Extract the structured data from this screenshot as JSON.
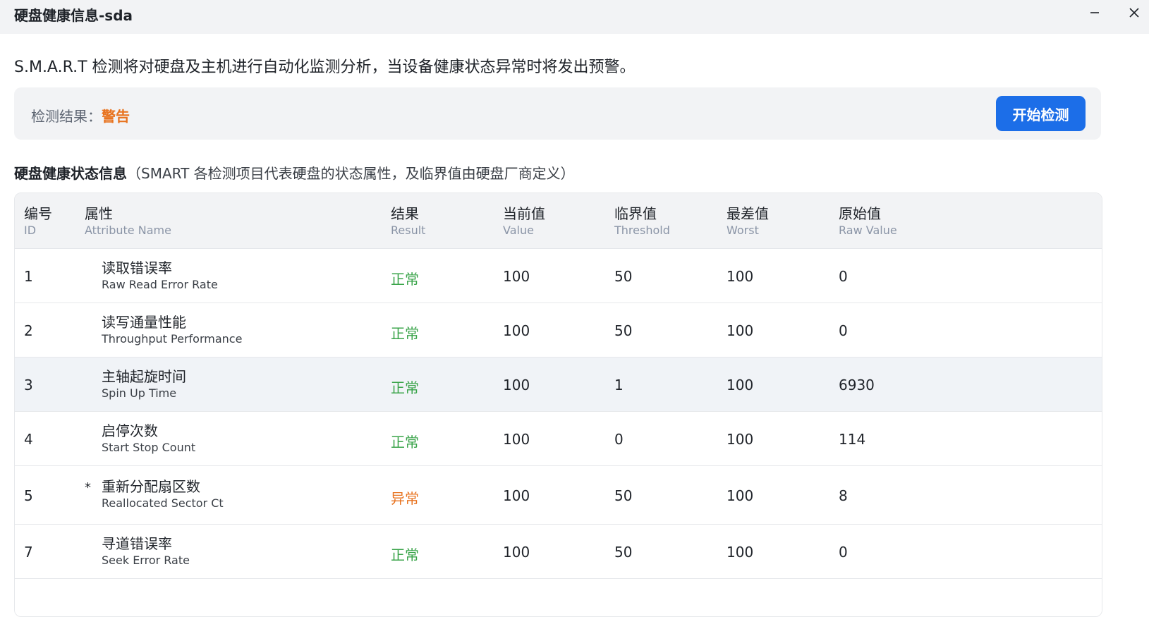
{
  "window": {
    "title": "硬盘健康信息-sda"
  },
  "intro": "S.M.A.R.T 检测将对硬盘及主机进行自动化监测分析，当设备健康状态异常时将发出预警。",
  "detection": {
    "label": "检测结果：",
    "value": "警告",
    "value_color": "#e8731f",
    "start_button": "开始检测",
    "button_color": "#1c6ee8"
  },
  "section": {
    "title": "硬盘健康状态信息",
    "subtitle": "（SMART 各检测项目代表硬盘的状态属性，及临界值由硬盘厂商定义）"
  },
  "table": {
    "columns": [
      {
        "zh": "编号",
        "en": "ID"
      },
      {
        "zh": "属性",
        "en": "Attribute Name"
      },
      {
        "zh": "结果",
        "en": "Result"
      },
      {
        "zh": "当前值",
        "en": "Value"
      },
      {
        "zh": "临界值",
        "en": "Threshold"
      },
      {
        "zh": "最差值",
        "en": "Worst"
      },
      {
        "zh": "原始值",
        "en": "Raw Value"
      }
    ],
    "rows": [
      {
        "id": "1",
        "star": "",
        "name_zh": "读取错误率",
        "name_en": "Raw Read Error Rate",
        "result": "正常",
        "status": "ok",
        "value": "100",
        "threshold": "50",
        "worst": "100",
        "raw": "0"
      },
      {
        "id": "2",
        "star": "",
        "name_zh": "读写通量性能",
        "name_en": "Throughput Performance",
        "result": "正常",
        "status": "ok",
        "value": "100",
        "threshold": "50",
        "worst": "100",
        "raw": "0"
      },
      {
        "id": "3",
        "star": "",
        "name_zh": "主轴起旋时间",
        "name_en": "Spin Up Time",
        "result": "正常",
        "status": "ok",
        "value": "100",
        "threshold": "1",
        "worst": "100",
        "raw": "6930"
      },
      {
        "id": "4",
        "star": "",
        "name_zh": "启停次数",
        "name_en": "Start Stop Count",
        "result": "正常",
        "status": "ok",
        "value": "100",
        "threshold": "0",
        "worst": "100",
        "raw": "114"
      },
      {
        "id": "5",
        "star": "*",
        "name_zh": "重新分配扇区数",
        "name_en": "Reallocated Sector Ct",
        "result": "异常",
        "status": "bad",
        "value": "100",
        "threshold": "50",
        "worst": "100",
        "raw": "8"
      },
      {
        "id": "7",
        "star": "",
        "name_zh": "寻道错误率",
        "name_en": "Seek Error Rate",
        "result": "正常",
        "status": "ok",
        "value": "100",
        "threshold": "50",
        "worst": "100",
        "raw": "0"
      }
    ]
  }
}
